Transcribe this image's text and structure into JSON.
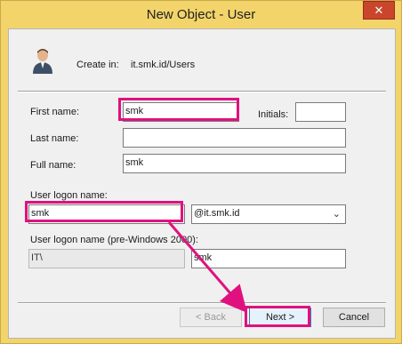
{
  "window": {
    "title": "New Object - User",
    "close_glyph": "✕"
  },
  "header": {
    "icon": "user-icon",
    "create_in_label": "Create in:",
    "create_in_value": "it.smk.id/Users"
  },
  "form": {
    "first_name_label": "First name:",
    "first_name_value": "smk",
    "initials_label": "Initials:",
    "initials_value": "",
    "last_name_label": "Last name:",
    "last_name_value": "",
    "full_name_label": "Full name:",
    "full_name_value": "smk",
    "logon_name_label": "User logon name:",
    "logon_name_value": "smk",
    "domain_value": "@it.smk.id",
    "pre2000_label": "User logon name (pre-Windows 2000):",
    "pre2000_domain_value": "IT\\",
    "pre2000_name_value": "smk"
  },
  "buttons": {
    "back_label": "< Back",
    "next_label": "Next >",
    "cancel_label": "Cancel"
  },
  "colors": {
    "highlight": "#e0117f",
    "title_bar": "#f3d46b"
  }
}
